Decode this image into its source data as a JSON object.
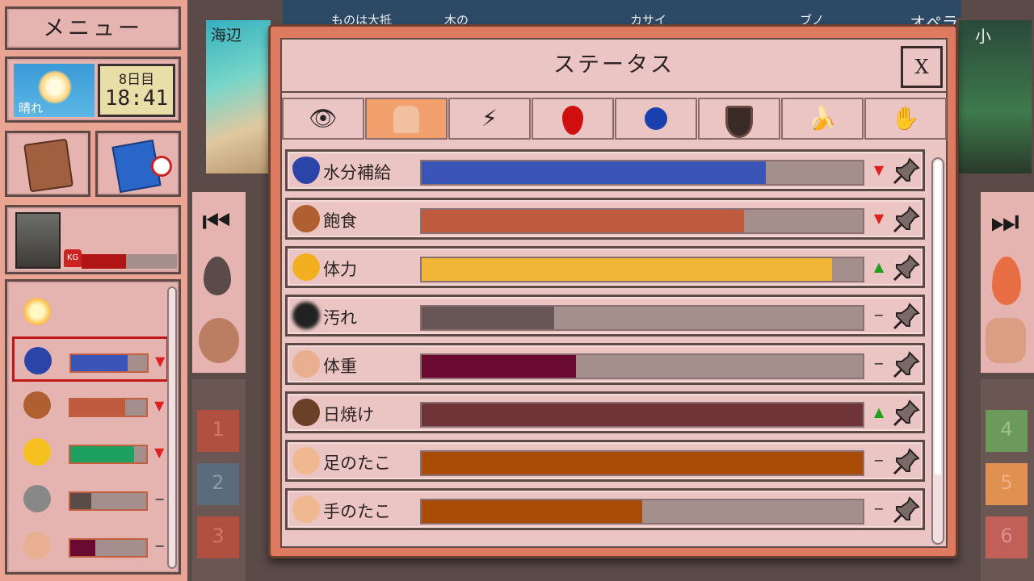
{
  "sidebar": {
    "menu_label": "メニュー",
    "weather": {
      "label": "晴れ",
      "day": "8日目",
      "time": "18:41"
    },
    "tools": [
      {
        "icon": "journal-icon"
      },
      {
        "icon": "blueprint-alarm-icon"
      }
    ],
    "player": {
      "weight_badge": "KG",
      "bar_value": 0.47,
      "bar_color": "#b01414"
    },
    "mini_stats": [
      {
        "icon": "sun-icon",
        "value": null,
        "color": "",
        "trend": ""
      },
      {
        "icon": "water-drop-icon",
        "value": 0.74,
        "color": "#3a54b8",
        "trend": "▼"
      },
      {
        "icon": "meat-icon",
        "value": 0.72,
        "color": "#c05a3e",
        "trend": "▼"
      },
      {
        "icon": "smiley-icon",
        "value": 0.84,
        "color": "#1ea060",
        "trend": "▼"
      },
      {
        "icon": "dirt-icon",
        "value": 0.28,
        "color": "#5a4a48",
        "trend": "−"
      },
      {
        "icon": "torso-icon",
        "value": 0.33,
        "color": "#6a0a30",
        "trend": "−"
      }
    ]
  },
  "scene": {
    "left_label": "海辺",
    "right_label": "小",
    "top_strip": [
      "ものは大抵",
      "木の",
      "カサイ",
      "ブノ",
      "オペラ"
    ],
    "flags_left": [
      "1",
      "2",
      "3"
    ],
    "flags_right": [
      "4",
      "5",
      "6"
    ]
  },
  "status": {
    "title": "ステータス",
    "close_label": "X",
    "tabs": [
      {
        "icon": "eye-icon",
        "glyph": "👁",
        "active": false
      },
      {
        "icon": "body-icon",
        "glyph": "",
        "active": true
      },
      {
        "icon": "lightning-icon",
        "glyph": "⚡",
        "active": false
      },
      {
        "icon": "blood-drop-icon",
        "glyph": "💧",
        "active": false
      },
      {
        "icon": "blue-ball-icon",
        "glyph": "●",
        "active": false
      },
      {
        "icon": "shield-icon",
        "glyph": "",
        "active": false
      },
      {
        "icon": "banana-icon",
        "glyph": "🍌",
        "active": false
      },
      {
        "icon": "hand-icon",
        "glyph": "✋",
        "active": false
      }
    ],
    "rows": [
      {
        "icon": "water-drop-icon",
        "label": "水分補給",
        "value": 0.78,
        "color": "#3a54b8",
        "trend": "▼",
        "trend_color": "#e02020"
      },
      {
        "icon": "meat-icon",
        "label": "飽食",
        "value": 0.73,
        "color": "#c05a3e",
        "trend": "▼",
        "trend_color": "#e02020"
      },
      {
        "icon": "energy-icon",
        "label": "体力",
        "value": 0.93,
        "color": "#f2b636",
        "trend": "▲",
        "trend_color": "#20a020"
      },
      {
        "icon": "dirt-icon",
        "label": "汚れ",
        "value": 0.3,
        "color": "#685656",
        "trend": "−",
        "trend_color": "#222"
      },
      {
        "icon": "torso-icon",
        "label": "体重",
        "value": 0.35,
        "color": "#6a0a30",
        "trend": "−",
        "trend_color": "#222"
      },
      {
        "icon": "tan-face-icon",
        "label": "日焼け",
        "value": 1.0,
        "color": "#6e3438",
        "trend": "▲",
        "trend_color": "#20a020"
      },
      {
        "icon": "foot-icon",
        "label": "足のたこ",
        "value": 1.0,
        "color": "#a84c08",
        "trend": "−",
        "trend_color": "#222"
      },
      {
        "icon": "palm-icon",
        "label": "手のたこ",
        "value": 0.5,
        "color": "#a84c08",
        "trend": "−",
        "trend_color": "#222"
      }
    ]
  }
}
